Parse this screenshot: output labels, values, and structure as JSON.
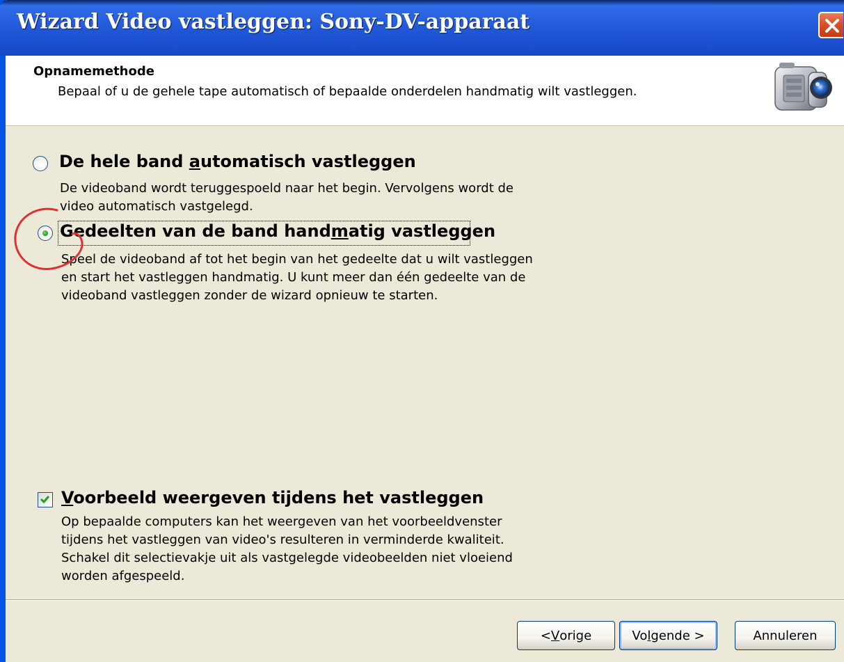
{
  "window": {
    "title": "Wizard Video vastleggen: Sony-DV-apparaat"
  },
  "header": {
    "title": "Opnamemethode",
    "subtitle": "Bepaal of u de gehele tape automatisch of bepaalde onderdelen handmatig wilt vastleggen.",
    "icon": "camcorder-icon"
  },
  "options": [
    {
      "label_pre": "De hele band ",
      "label_accel": "a",
      "label_post": "utomatisch vastleggen",
      "desc_lines": [
        "De videoband wordt teruggespoeld naar het begin. Vervolgens wordt de",
        "video automatisch vastgelegd."
      ],
      "selected": false
    },
    {
      "label_pre": "Gedeelten van de band hand",
      "label_accel": "m",
      "label_post": "atig vastleggen",
      "desc_lines": [
        "Speel de videoband af tot het begin van het gedeelte dat u wilt vastleggen",
        "en start het vastleggen handmatig. U kunt meer dan één gedeelte van de",
        "videoband vastleggen zonder de wizard opnieuw te starten."
      ],
      "selected": true
    }
  ],
  "preview": {
    "label_accel": "V",
    "label_post": "oorbeeld weergeven tijdens het vastleggen",
    "checked": true,
    "desc_lines": [
      "Op bepaalde computers kan het weergeven van het voorbeeldvenster",
      "tijdens het vastleggen van video's resulteren in verminderde kwaliteit.",
      "Schakel dit selectievakje uit als vastgelegde videobeelden niet vloeiend",
      "worden afgespeeld."
    ]
  },
  "buttons": {
    "back_pre": "< ",
    "back_accel": "V",
    "back_post": "orige",
    "next_pre": "Vo",
    "next_accel": "l",
    "next_post": "gende >",
    "cancel": "Annuleren"
  },
  "colors": {
    "titlebar": "#2B62E0",
    "annotation": "#E03030",
    "dialog_bg": "#ECE9D8"
  }
}
